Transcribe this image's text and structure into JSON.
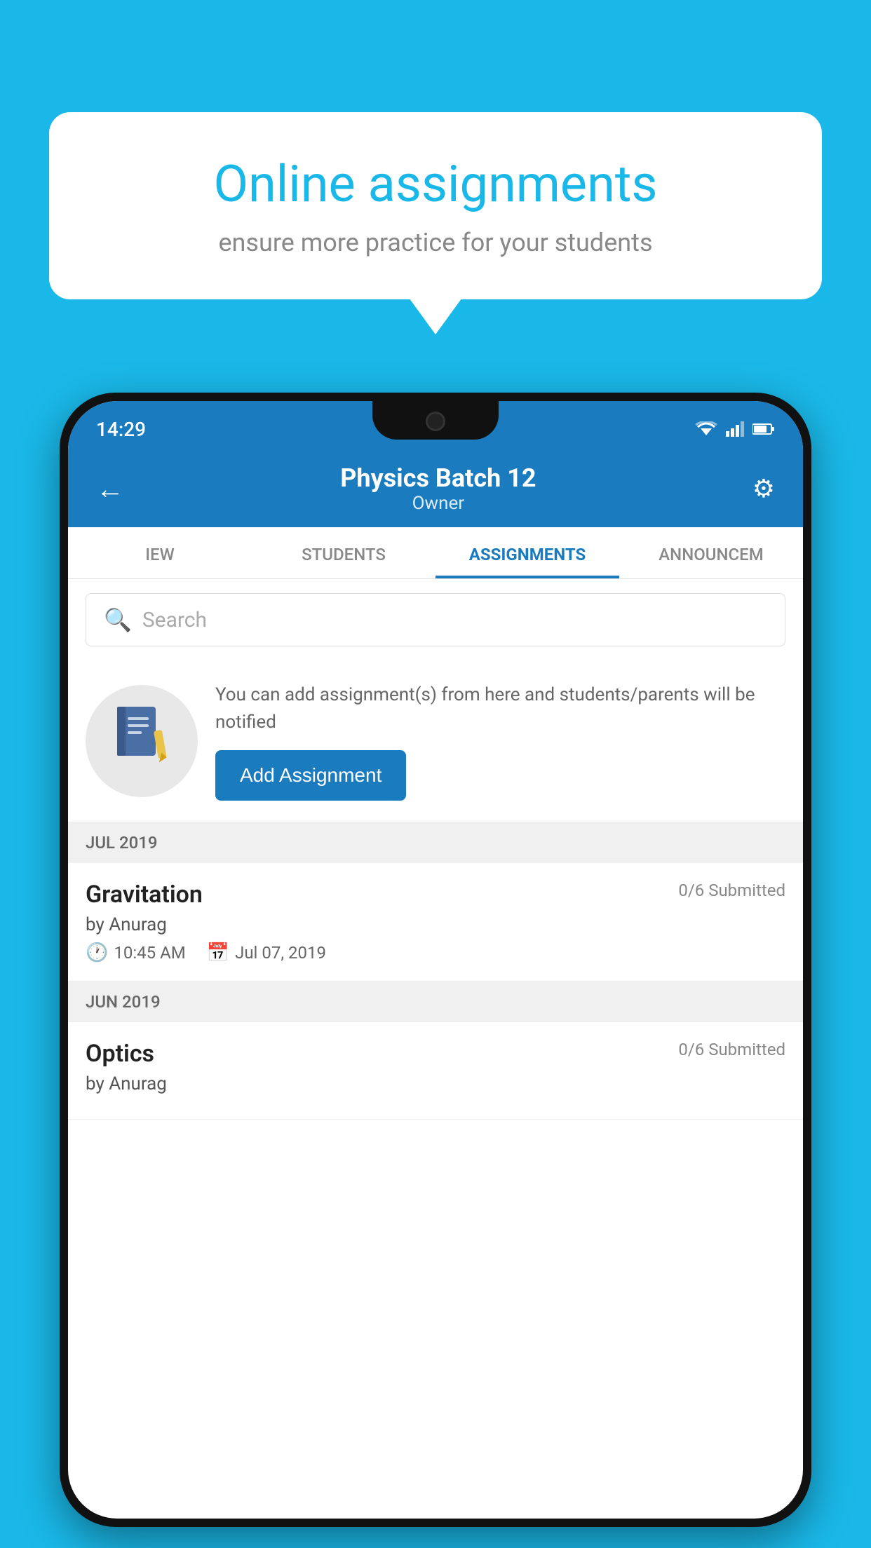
{
  "background_color": "#1ab8e8",
  "speech_bubble": {
    "title": "Online assignments",
    "subtitle": "ensure more practice for your students"
  },
  "status_bar": {
    "time": "14:29"
  },
  "header": {
    "title": "Physics Batch 12",
    "subtitle": "Owner",
    "back_label": "←",
    "settings_label": "⚙"
  },
  "tabs": [
    {
      "label": "IEW",
      "active": false
    },
    {
      "label": "STUDENTS",
      "active": false
    },
    {
      "label": "ASSIGNMENTS",
      "active": true
    },
    {
      "label": "ANNOUNCEM",
      "active": false
    }
  ],
  "search": {
    "placeholder": "Search"
  },
  "promo": {
    "icon": "📓",
    "text": "You can add assignment(s) from here and students/parents will be notified",
    "button_label": "Add Assignment"
  },
  "sections": [
    {
      "header": "JUL 2019",
      "assignments": [
        {
          "name": "Gravitation",
          "submitted": "0/6 Submitted",
          "by": "by Anurag",
          "time": "10:45 AM",
          "date": "Jul 07, 2019"
        }
      ]
    },
    {
      "header": "JUN 2019",
      "assignments": [
        {
          "name": "Optics",
          "submitted": "0/6 Submitted",
          "by": "by Anurag",
          "time": "",
          "date": ""
        }
      ]
    }
  ]
}
